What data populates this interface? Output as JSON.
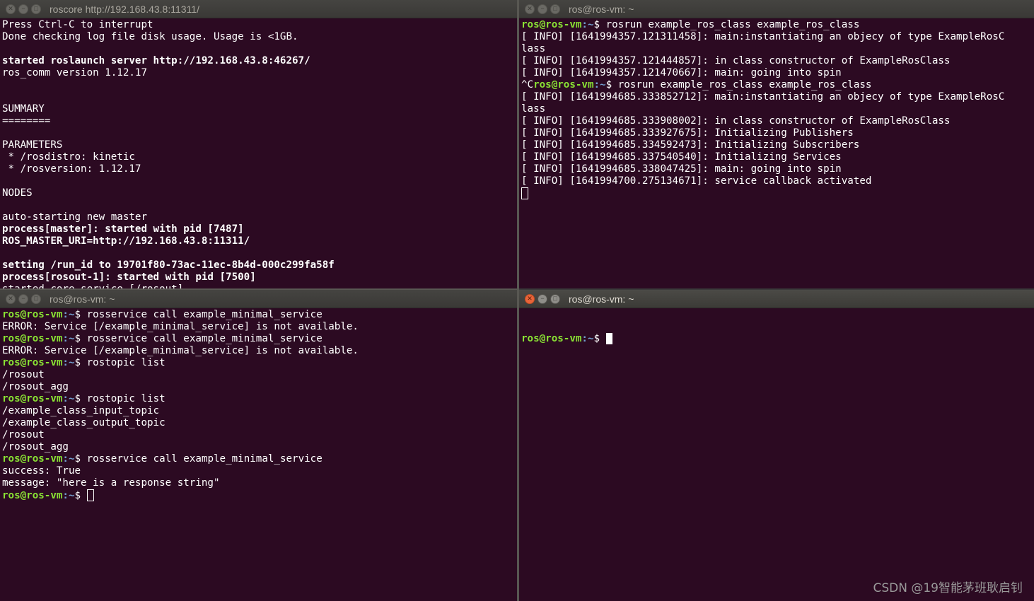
{
  "windows": {
    "top_left": {
      "title": "roscore http://192.168.43.8:11311/",
      "lines": [
        {
          "text": "Press Ctrl-C to interrupt",
          "bold": false
        },
        {
          "text": "Done checking log file disk usage. Usage is <1GB.",
          "bold": false
        },
        {
          "text": "",
          "bold": false
        },
        {
          "text": "started roslaunch server http://192.168.43.8:46267/",
          "bold": true
        },
        {
          "text": "ros_comm version 1.12.17",
          "bold": false
        },
        {
          "text": "",
          "bold": false
        },
        {
          "text": "",
          "bold": false
        },
        {
          "text": "SUMMARY",
          "bold": false
        },
        {
          "text": "========",
          "bold": false
        },
        {
          "text": "",
          "bold": false
        },
        {
          "text": "PARAMETERS",
          "bold": false
        },
        {
          "text": " * /rosdistro: kinetic",
          "bold": false
        },
        {
          "text": " * /rosversion: 1.12.17",
          "bold": false
        },
        {
          "text": "",
          "bold": false
        },
        {
          "text": "NODES",
          "bold": false
        },
        {
          "text": "",
          "bold": false
        },
        {
          "text": "auto-starting new master",
          "bold": false
        },
        {
          "text": "process[master]: started with pid [7487]",
          "bold": true
        },
        {
          "text": "ROS_MASTER_URI=http://192.168.43.8:11311/",
          "bold": true
        },
        {
          "text": "",
          "bold": false
        },
        {
          "text": "setting /run_id to 19701f80-73ac-11ec-8b4d-000c299fa58f",
          "bold": true
        },
        {
          "text": "process[rosout-1]: started with pid [7500]",
          "bold": true
        },
        {
          "text": "started core service [/rosout]",
          "bold": false
        }
      ]
    },
    "top_right": {
      "title": "ros@ros-vm: ~",
      "prompt_user": "ros@ros-vm",
      "prompt_path": ":~",
      "prompt_symbol": "$ ",
      "lines": [
        {
          "pre": "",
          "prompt": true,
          "cmd": "rosrun example_ros_class example_ros_class"
        },
        {
          "pre": "",
          "prompt": false,
          "cmd": "[ INFO] [1641994357.121311458]: main:instantiating an objecy of type ExampleRosC"
        },
        {
          "pre": "",
          "prompt": false,
          "cmd": "lass"
        },
        {
          "pre": "",
          "prompt": false,
          "cmd": "[ INFO] [1641994357.121444857]: in class constructor of ExampleRosClass"
        },
        {
          "pre": "",
          "prompt": false,
          "cmd": "[ INFO] [1641994357.121470667]: main: going into spin"
        },
        {
          "pre": "^C",
          "prompt": true,
          "cmd": "rosrun example_ros_class example_ros_class"
        },
        {
          "pre": "",
          "prompt": false,
          "cmd": "[ INFO] [1641994685.333852712]: main:instantiating an objecy of type ExampleRosC"
        },
        {
          "pre": "",
          "prompt": false,
          "cmd": "lass"
        },
        {
          "pre": "",
          "prompt": false,
          "cmd": "[ INFO] [1641994685.333908002]: in class constructor of ExampleRosClass"
        },
        {
          "pre": "",
          "prompt": false,
          "cmd": "[ INFO] [1641994685.333927675]: Initializing Publishers"
        },
        {
          "pre": "",
          "prompt": false,
          "cmd": "[ INFO] [1641994685.334592473]: Initializing Subscribers"
        },
        {
          "pre": "",
          "prompt": false,
          "cmd": "[ INFO] [1641994685.337540540]: Initializing Services"
        },
        {
          "pre": "",
          "prompt": false,
          "cmd": "[ INFO] [1641994685.338047425]: main: going into spin"
        },
        {
          "pre": "",
          "prompt": false,
          "cmd": "[ INFO] [1641994700.275134671]: service callback activated"
        }
      ]
    },
    "bottom_left": {
      "title": "ros@ros-vm: ~",
      "lines": [
        {
          "prompt": true,
          "cmd": "rosservice call example_minimal_service"
        },
        {
          "prompt": false,
          "cmd": "ERROR: Service [/example_minimal_service] is not available."
        },
        {
          "prompt": true,
          "cmd": "rosservice call example_minimal_service"
        },
        {
          "prompt": false,
          "cmd": "ERROR: Service [/example_minimal_service] is not available."
        },
        {
          "prompt": true,
          "cmd": "rostopic list"
        },
        {
          "prompt": false,
          "cmd": "/rosout"
        },
        {
          "prompt": false,
          "cmd": "/rosout_agg"
        },
        {
          "prompt": true,
          "cmd": "rostopic list"
        },
        {
          "prompt": false,
          "cmd": "/example_class_input_topic"
        },
        {
          "prompt": false,
          "cmd": "/example_class_output_topic"
        },
        {
          "prompt": false,
          "cmd": "/rosout"
        },
        {
          "prompt": false,
          "cmd": "/rosout_agg"
        },
        {
          "prompt": true,
          "cmd": "rosservice call example_minimal_service"
        },
        {
          "prompt": false,
          "cmd": "success: True"
        },
        {
          "prompt": false,
          "cmd": "message: \"here is a response string\""
        }
      ]
    },
    "bottom_right": {
      "title": "ros@ros-vm: ~"
    }
  },
  "prompt": {
    "user": "ros@ros-vm",
    "path": ":~",
    "symbol": "$ "
  },
  "watermark": "CSDN @19智能茅班耿启钊",
  "colors": {
    "terminal_bg": "#2c0a22",
    "prompt_user": "#8ae234",
    "prompt_path": "#729fcf",
    "close_active": "#e8643a"
  }
}
